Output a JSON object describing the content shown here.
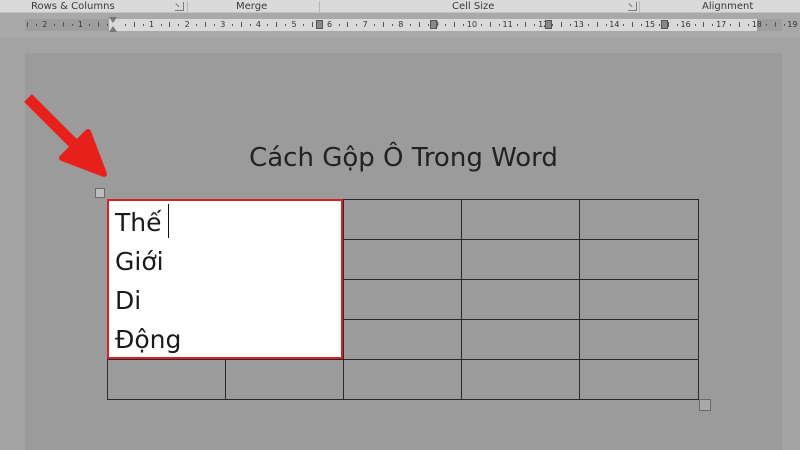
{
  "ribbon": {
    "groups": [
      {
        "label": "Rows & Columns",
        "has_launcher": true
      },
      {
        "label": "Merge",
        "has_launcher": false
      },
      {
        "label": "Cell Size",
        "has_launcher": true
      },
      {
        "label": "Alignment",
        "has_launcher": false
      }
    ]
  },
  "ruler": {
    "numbers": [
      "2",
      "1",
      "1",
      "2",
      "3",
      "4",
      "5",
      "6",
      "7",
      "8",
      "9",
      "10",
      "11",
      "12",
      "13",
      "14",
      "15",
      "16",
      "17",
      "18",
      "19"
    ]
  },
  "document": {
    "title": "Cách Gộp Ô Trong Word",
    "merged_cell_lines": [
      "Thế",
      "Giới",
      "Di",
      "Động"
    ]
  },
  "table": {
    "rows": 5,
    "columns": 5,
    "merged": {
      "rows": 4,
      "columns": 2
    }
  },
  "colors": {
    "highlight": "#d6202a",
    "arrow": "#e8201c",
    "page_shade": "#9b9b9b"
  },
  "icons": {
    "annotation": "red-arrow-icon",
    "table_move": "table-move-handle-icon",
    "table_resize": "table-resize-handle-icon"
  }
}
